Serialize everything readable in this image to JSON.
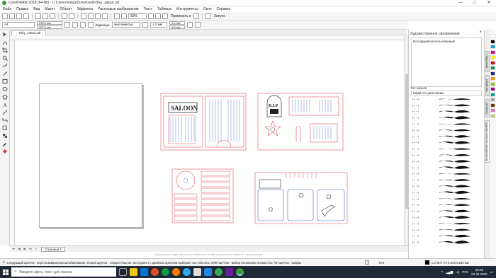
{
  "window": {
    "title": "CorelDRAW 2018 (64-Bit) - C:\\Users\\mdup\\Downloads\\Diky_zakad.cdr",
    "minimize": "—",
    "maximize": "□",
    "close": "✕"
  },
  "menu": [
    "Файл",
    "Правка",
    "Вид",
    "Макет",
    "Объект",
    "Эффекты",
    "Растровые изображения",
    "Текст",
    "Таблица",
    "Инструменты",
    "Окно",
    "Справка"
  ],
  "toolbar": {
    "zoom": "50%",
    "snap_label": "Привязать к",
    "launch_label": "Запуск"
  },
  "propbar": {
    "paper": "A4",
    "width": "210,0 мм",
    "height": "297,0 мм",
    "units_label": "Единицы:",
    "units_value": "миллиметры",
    "nudge": "4,0 мм",
    "dup_x": "5,0 мм",
    "dup_y": "5,0 мм"
  },
  "document_tab": "Diky_zakad.cdr",
  "page_tab": "Страница 1",
  "canvas_hint": "Перетащите сюда цвета (или объекты), чтобы сохранить их вместе с документом",
  "status_text": "Следующий щелчок - перетаскивание/масштабирование; второй щелчок - поворот/наклон; инструмент с двойным щелчком выбирает все объекты; Shift+щелчок - выбор нескольких элементов; Alt+щелчок - цифры",
  "status_fill": "Нет",
  "status_color": "C:0 M:0 Y:0 K:100  0,200 мм",
  "docker": {
    "title": "Художественное оформление",
    "recent_label": "Последний использованный",
    "brush_type_label": "Тип мазков",
    "brush_type_value": "Мазки по умолчанию"
  },
  "docker_tabs": [
    "Подсказки",
    "Свойства",
    "Объекты",
    "Художественное оформление"
  ],
  "palette_colors": [
    "#ffffff",
    "#000000",
    "#00a0e3",
    "#e4007f",
    "#fff100",
    "#e60012",
    "#009944",
    "#1d2088",
    "#f39800",
    "#8fc31f",
    "#920783",
    "#00a29a",
    "#a0a0a0",
    "#6a3906",
    "#ea68a2",
    "#b3d465"
  ],
  "taskbar": {
    "search_placeholder": "Введите здесь текст для поиска",
    "lang": "РУС",
    "time": "22:52",
    "date": "02.04.2020"
  }
}
